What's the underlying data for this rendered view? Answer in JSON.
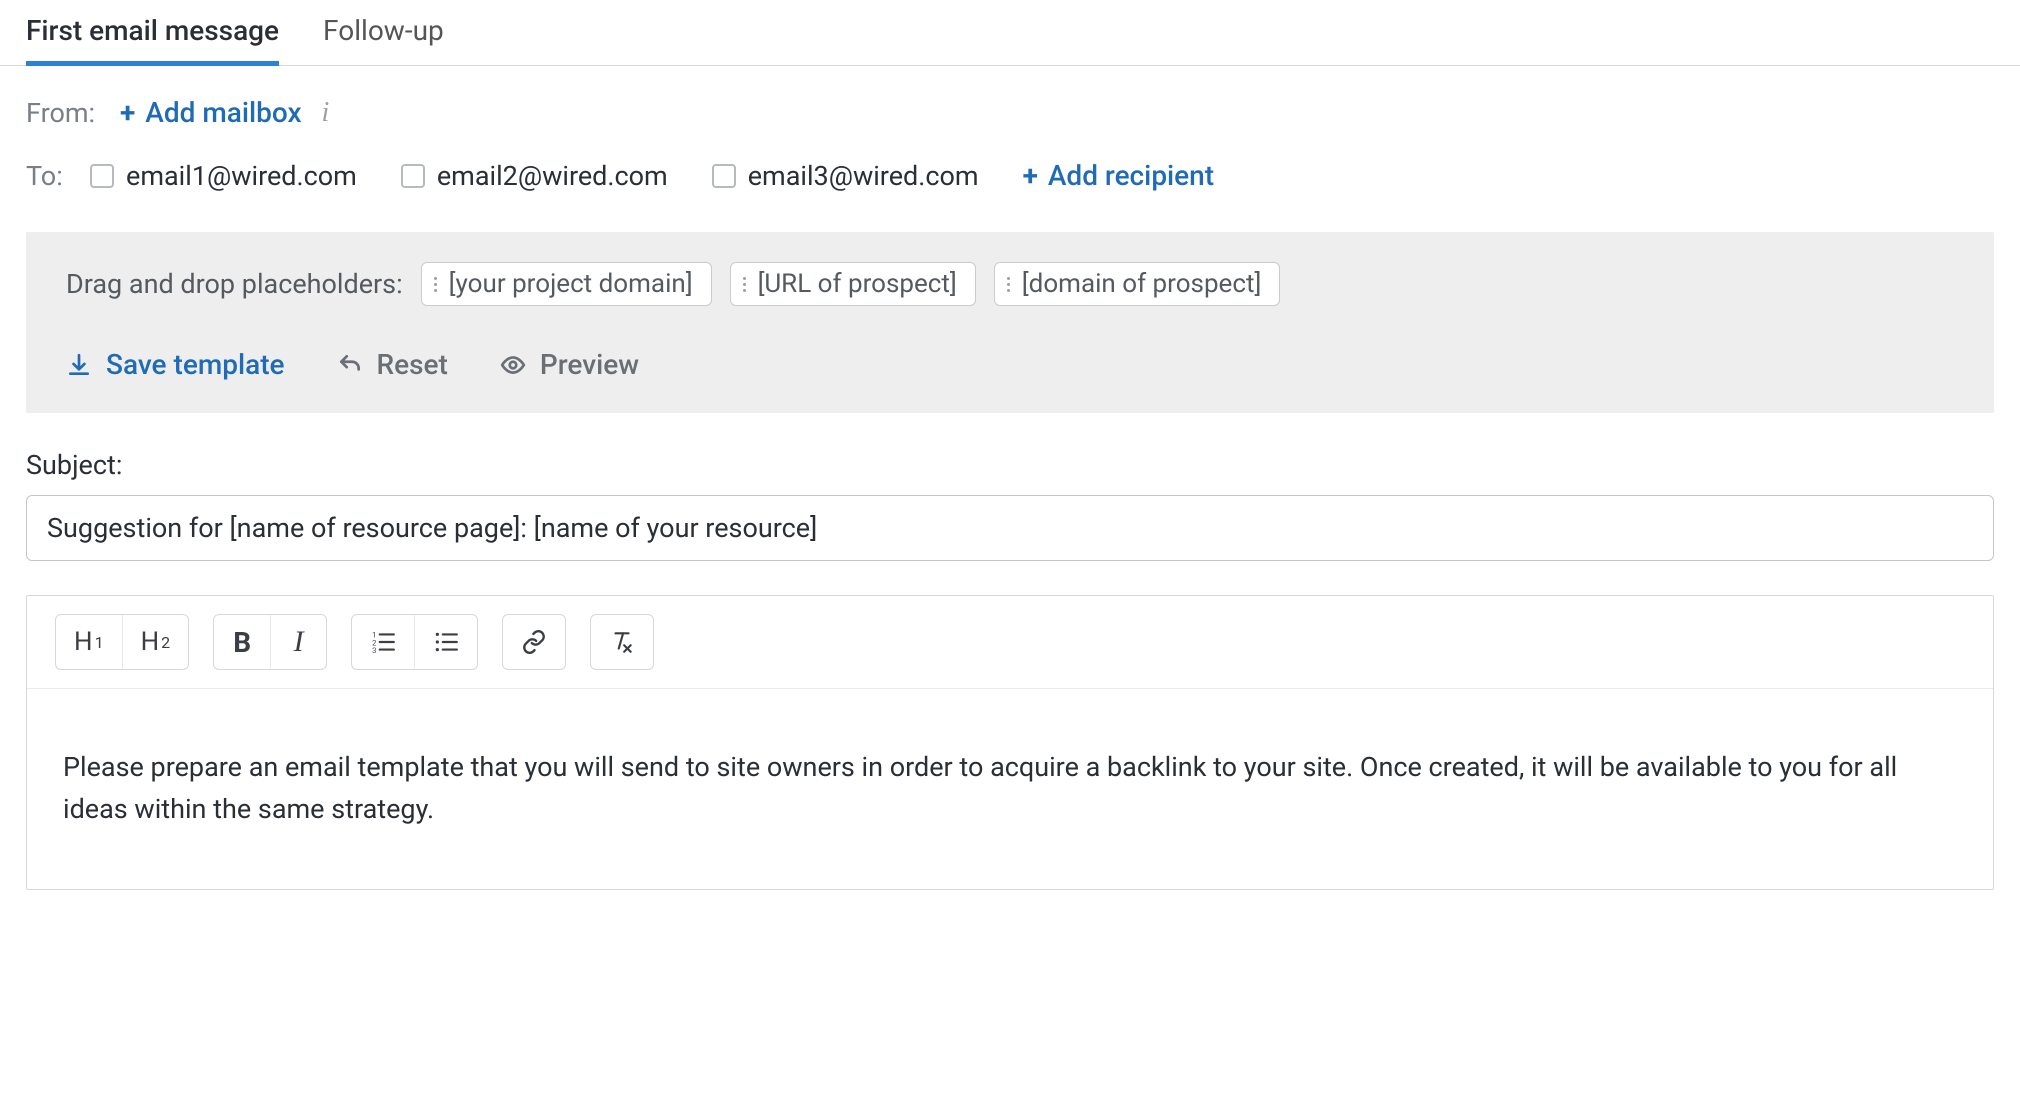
{
  "tabs": {
    "first": "First email message",
    "followup": "Follow-up"
  },
  "from": {
    "label": "From:",
    "add_mailbox": "Add mailbox"
  },
  "to": {
    "label": "To:",
    "recipients": [
      "email1@wired.com",
      "email2@wired.com",
      "email3@wired.com"
    ],
    "add_recipient": "Add recipient"
  },
  "placeholders": {
    "label": "Drag and drop placeholders:",
    "items": [
      "[your project domain]",
      "[URL of prospect]",
      "[domain of prospect]"
    ]
  },
  "actions": {
    "save_template": "Save template",
    "reset": "Reset",
    "preview": "Preview"
  },
  "subject": {
    "label": "Subject:",
    "value": "Suggestion for [name of resource page]: [name of your resource]"
  },
  "editor": {
    "body": "Please prepare an email template that you will send to site owners in order to acquire a backlink to your site. Once created, it will be available to you for all ideas within the same strategy."
  }
}
